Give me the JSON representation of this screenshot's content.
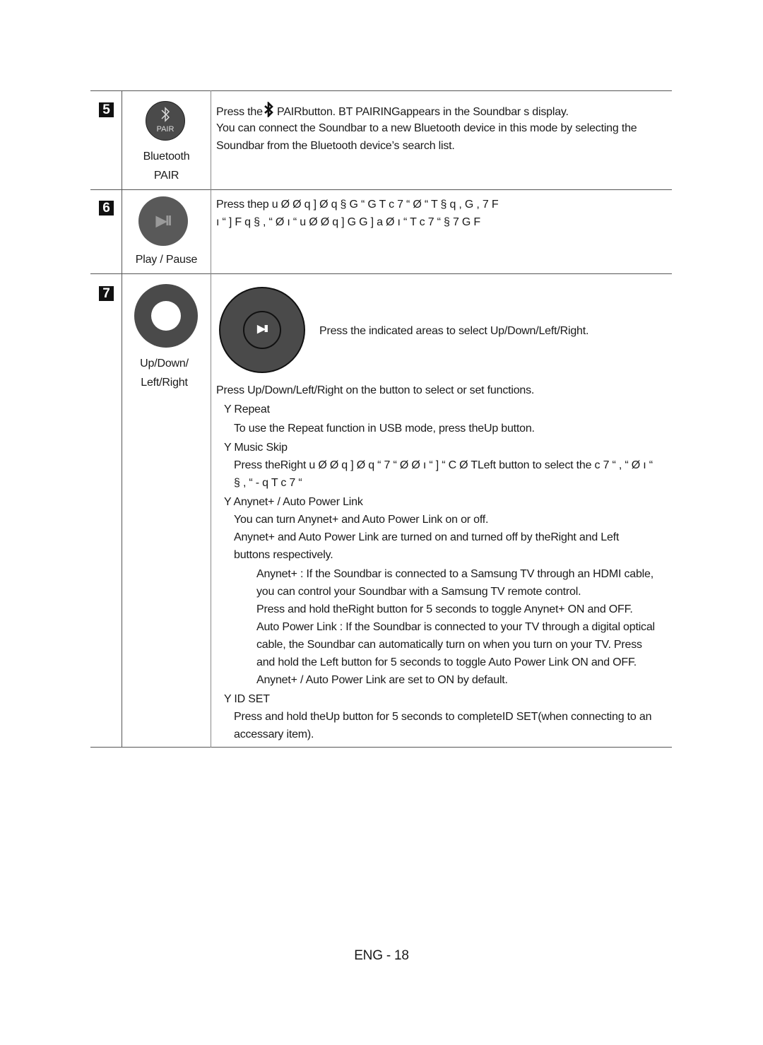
{
  "sections": [
    {
      "number": "5",
      "button_name": "Bluetooth",
      "button_name_2": "PAIR",
      "icon_label": "PAIR",
      "lines": [
        {
          "pre": "Press the",
          "post": " PAIRbutton.  BT PAIRINGappears in the Soundbar s display."
        },
        {
          "text": "You can connect the Soundbar to a new Bluetooth device in this mode by selecting the"
        },
        {
          "text": "Soundbar from the Bluetooth device’s search list."
        }
      ]
    },
    {
      "number": "6",
      "button_name": "Play / Pause",
      "icon_glyph": "▶II",
      "lines": [
        {
          "text": "Press thep    u  Ø Ø q ]  Ø q  § G    “  G  T          c 7 “  Ø “ T § q , G ,  7 F"
        },
        {
          "text": " ı “ ]  F q    § , “      Ø ı “  u  Ø Ø q ]  G  G  ] a  Ø ı “  T          c 7 “  § 7 G F"
        }
      ]
    },
    {
      "number": "7",
      "button_name": "Up/Down/",
      "button_name_2": "Left/Right",
      "dial_glyph": "▶II",
      "dial_caption": "Press the indicated areas to select Up/Down/Left/Right.",
      "intro": "Press Up/Down/Left/Right on the button to select or set functions.",
      "items": [
        {
          "heading": "Y Repeat",
          "lines": [
            "To use the Repeat function in USB mode, press theUp button."
          ]
        },
        {
          "heading": "Y Music Skip",
          "lines": [
            "Press theRight   u  Ø Ø q ]  Ø q     “ 7 “   Ø   Ø ı “   ] “ C Ø   TLeft button to select the  c 7 “ , “  Ø ı “",
            "§ , “ -  q      T           c 7 “"
          ]
        },
        {
          "heading": "Y Anynet+ / Auto Power Link",
          "lines": [
            "You can turn Anynet+ and Auto Power Link on or off.",
            "Anynet+ and Auto Power Link are turned on and turned off by theRight  and Left",
            "buttons respectively."
          ]
        },
        {
          "sub_lines": [
            "Anynet+ : If the Soundbar is connected to a Samsung TV through an HDMI cable,",
            "you can control your Soundbar with a Samsung TV remote control.",
            "Press and hold theRight  button for 5 seconds to toggle Anynet+ ON and OFF.",
            "Auto Power Link : If the Soundbar is connected to your TV through a digital optical",
            "cable, the Soundbar can automatically turn on when you turn on your TV. Press",
            "and hold the Left  button for 5 seconds to toggle Auto Power Link ON and OFF.",
            "Anynet+ / Auto Power Link are set to ON by default."
          ]
        },
        {
          "heading": "Y ID SET",
          "lines": [
            "Press and hold theUp button for 5 seconds to completeID SET(when connecting to an",
            "accessary item)."
          ]
        }
      ]
    }
  ],
  "footer": {
    "page_label": "ENG - 18"
  }
}
